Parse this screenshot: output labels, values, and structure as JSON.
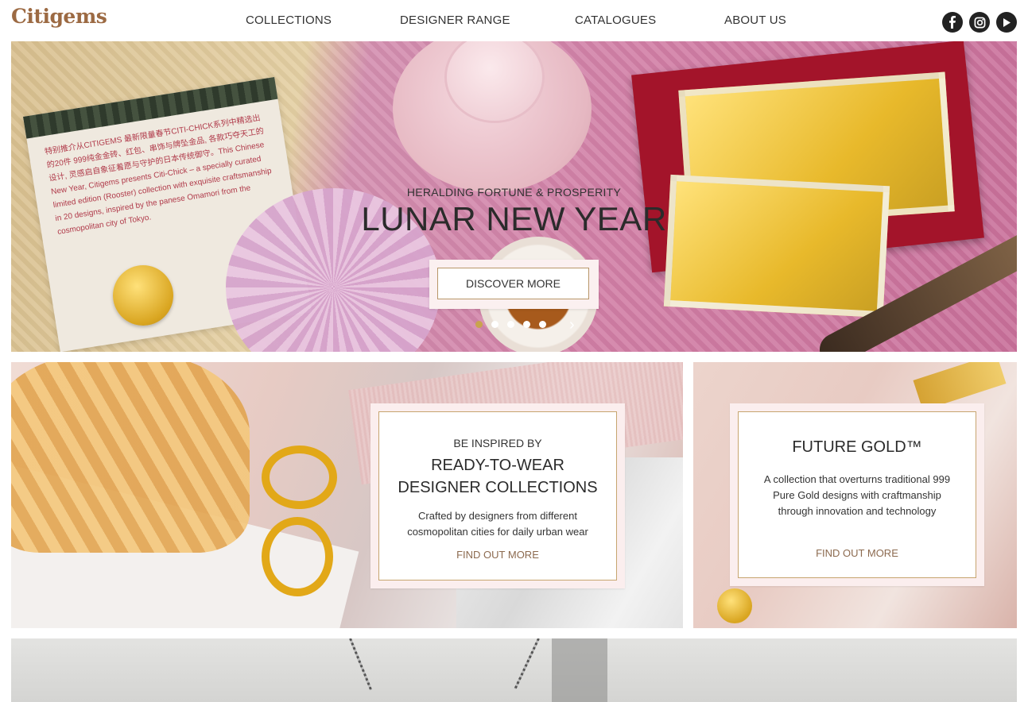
{
  "brand": {
    "logo": "Citigems",
    "color": "#9c6a43"
  },
  "nav": {
    "items": [
      {
        "label": "COLLECTIONS"
      },
      {
        "label": "DESIGNER RANGE"
      },
      {
        "label": "CATALOGUES"
      },
      {
        "label": "ABOUT US"
      }
    ]
  },
  "social": [
    "facebook-icon",
    "instagram-icon",
    "youtube-icon"
  ],
  "hero": {
    "card_text": "特别推介从CITIGEMS 最新限量春节CITI-CHICK系列中精选出的20件 999纯金金砖、红包、串饰与牌坠金品, 各款巧夺天工的设计, 灵感启自象征着愿与守护的日本传统御守。This Chinese New Year, Citigems presents Citi-Chick – a specially curated limited edition (Rooster) collection with exquisite craftsmanship in 20 designs, inspired by the panese Omamori from the cosmopolitan city of Tokyo.",
    "kicker": "HERALDING FORTUNE & PROSPERITY",
    "title": "LUNAR NEW YEAR",
    "cta": "DISCOVER MORE",
    "slides": 5,
    "active_slide": 0,
    "next_arrow": "›"
  },
  "promo_designer": {
    "kicker": "BE INSPIRED BY",
    "title_line1": "READY-TO-WEAR",
    "title_line2": "DESIGNER COLLECTIONS",
    "desc_line1": "Crafted by designers from different",
    "desc_line2": "cosmopolitan cities for daily urban wear",
    "link": "FIND OUT MORE"
  },
  "promo_future_gold": {
    "title": "FUTURE GOLD™",
    "desc_line1": "A collection that overturns traditional 999",
    "desc_line2": "Pure Gold designs with craftmanship",
    "desc_line3": "through innovation and technology",
    "link": "FIND OUT MORE"
  },
  "colors": {
    "accent": "#c7a56f",
    "link": "#8c6a4f",
    "card_bg": "#fbeeee"
  }
}
